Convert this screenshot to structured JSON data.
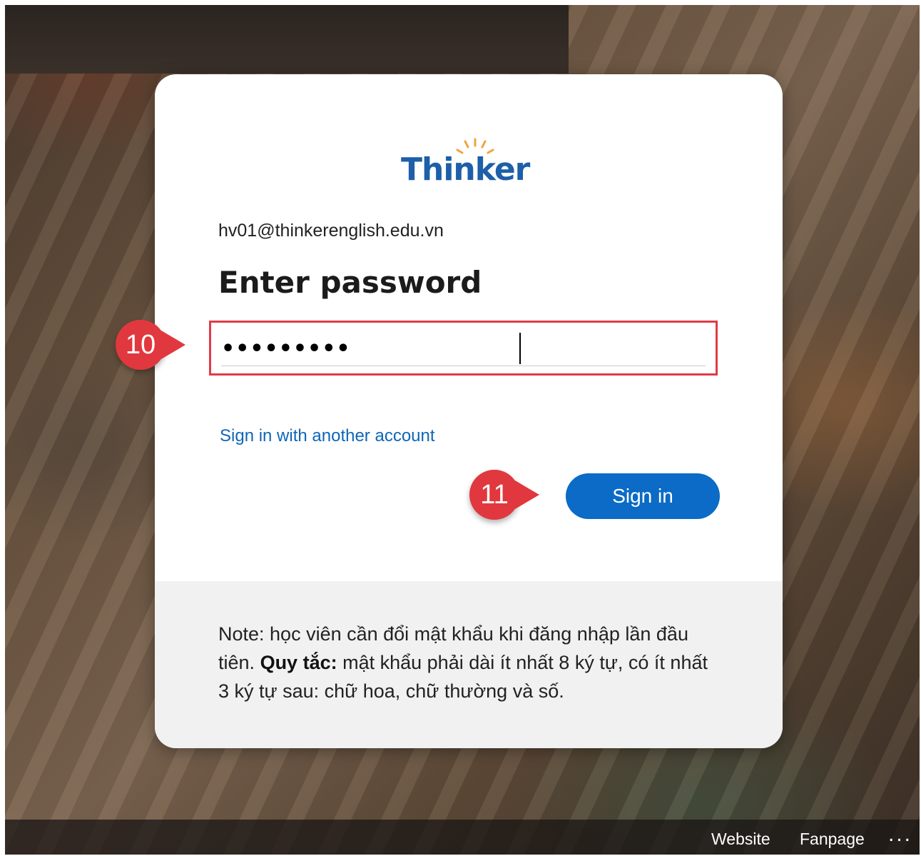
{
  "brand": {
    "logo_text": "Thinker",
    "logo_color": "#1d5fa8",
    "bulb_color": "#f2a33a"
  },
  "login": {
    "email": "hv01@thinkerenglish.edu.vn",
    "heading": "Enter password",
    "password_value": "•••••••••",
    "alt_link": "Sign in with another account",
    "signin_label": "Sign in"
  },
  "note": {
    "prefix": "Note: học viên cần đổi mật khẩu khi đăng nhập lần đầu tiên.",
    "rule_label": "Quy tắc:",
    "rule_text": "mật khẩu phải dài ít nhất 8 ký tự, có ít nhất 3 ký tự sau: chữ hoa, chữ thường và số."
  },
  "annotations": {
    "step_password": "10",
    "step_signin": "11"
  },
  "footer": {
    "website": "Website",
    "fanpage": "Fanpage",
    "more": "..."
  },
  "colors": {
    "accent": "#0b6bc6",
    "highlight": "#e23a46",
    "badge": "#e0383e"
  }
}
